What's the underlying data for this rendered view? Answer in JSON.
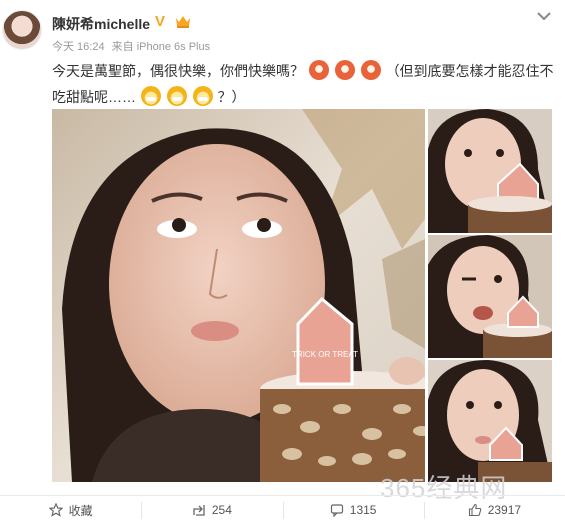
{
  "post": {
    "author": "陳妍希michelle",
    "verified_badge": "V",
    "meta": {
      "time": "今天 16:24",
      "source": "来自 iPhone 6s Plus"
    },
    "text_1": "今天是萬聖節，偶很快樂，你們快樂嗎？",
    "text_2": "（但到底要怎樣才能忍住不吃甜點呢……",
    "text_3": "？）",
    "emoticons_a": [
      "red-face-icon",
      "red-face-icon",
      "red-face-icon"
    ],
    "emoticons_b": [
      "yellow-face-icon",
      "yellow-face-icon",
      "yellow-face-icon"
    ]
  },
  "photos": {
    "cake_tag_text": "TRICK OR TREAT",
    "count": 4
  },
  "watermark": "365经典网",
  "actions": {
    "favorite_label": "收藏",
    "share_count": "254",
    "comment_count": "1315",
    "like_count": "23917"
  },
  "colors": {
    "accent_badge": "#f5a623",
    "text": "#333333",
    "meta": "#999999"
  }
}
